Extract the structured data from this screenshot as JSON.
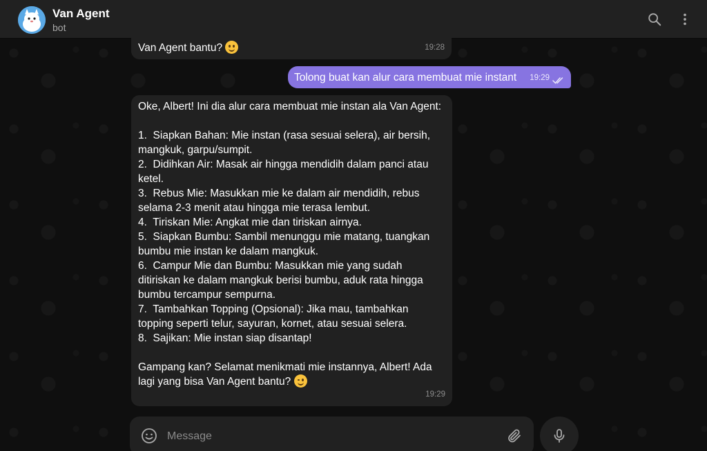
{
  "header": {
    "title": "Van Agent",
    "subtitle": "bot",
    "icons": {
      "search": "search-icon",
      "more": "more-vertical-icon"
    }
  },
  "messages": [
    {
      "direction": "incoming",
      "text": "Van Agent bantu? ",
      "emoji": "smiling-face",
      "time": "19:28"
    },
    {
      "direction": "outgoing",
      "text": "Tolong buat kan alur cara membuat mie instant",
      "time": "19:29",
      "status": "read"
    },
    {
      "direction": "incoming",
      "text": "Oke, Albert! Ini dia alur cara membuat mie instan ala Van Agent:\n\n1.  Siapkan Bahan: Mie instan (rasa sesuai selera), air bersih, mangkuk, garpu/sumpit.\n2.  Didihkan Air: Masak air hingga mendidih dalam panci atau ketel.\n3.  Rebus Mie: Masukkan mie ke dalam air mendidih, rebus selama 2-3 menit atau hingga mie terasa lembut.\n4.  Tiriskan Mie: Angkat mie dan tiriskan airnya.\n5.  Siapkan Bumbu: Sambil menunggu mie matang, tuangkan bumbu mie instan ke dalam mangkuk.\n6.  Campur Mie dan Bumbu: Masukkan mie yang sudah ditiriskan ke dalam mangkuk berisi bumbu, aduk rata hingga bumbu tercampur sempurna.\n7.  Tambahkan Topping (Opsional): Jika mau, tambahkan topping seperti telur, sayuran, kornet, atau sesuai selera.\n8.  Sajikan: Mie instan siap disantap!\n\nGampang kan? Selamat menikmati mie instannya, Albert! Ada lagi yang bisa Van Agent bantu? ",
      "emoji": "winking-face",
      "time": "19:29"
    }
  ],
  "composer": {
    "placeholder": "Message",
    "icons": {
      "emoji": "smile-icon",
      "attach": "paperclip-icon",
      "voice": "microphone-icon"
    }
  },
  "colors": {
    "accent": "#8774e1",
    "bubble_in": "#212121",
    "header_bg": "#212121",
    "background": "#0f0f0f"
  }
}
